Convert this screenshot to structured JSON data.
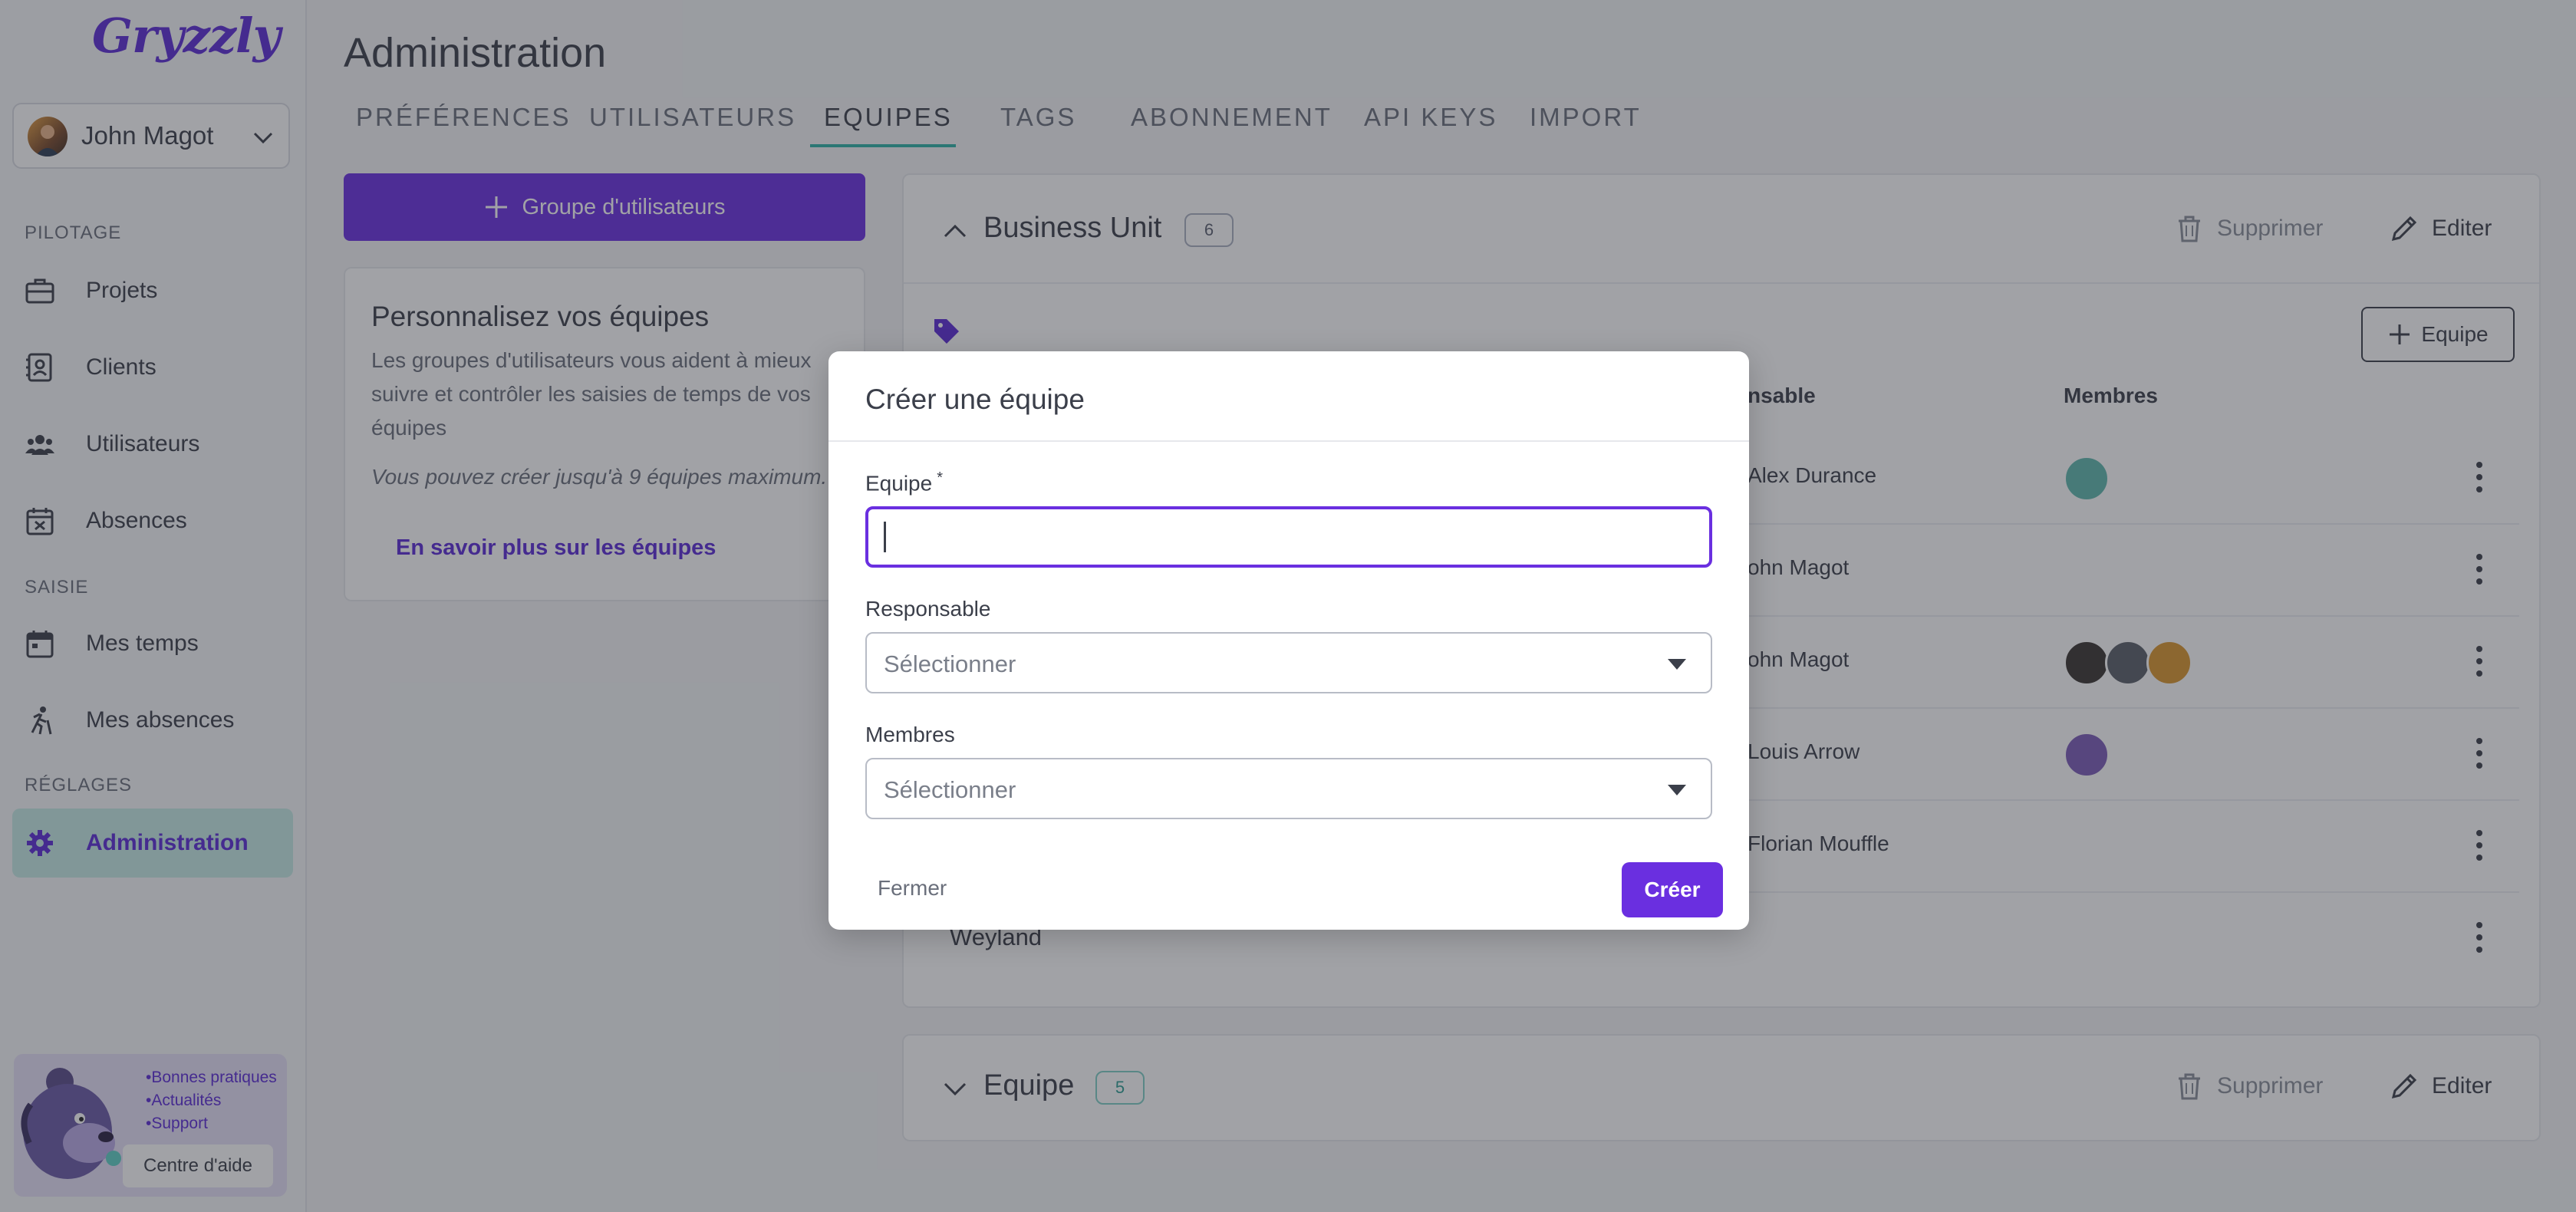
{
  "sidebar": {
    "logo": "Gryzzly",
    "user": {
      "name": "John Magot"
    },
    "sections": {
      "pilotage": "PILOTAGE",
      "saisie": "SAISIE",
      "reglages": "RÉGLAGES"
    },
    "items": [
      {
        "label": "Projets",
        "icon": "briefcase-icon"
      },
      {
        "label": "Clients",
        "icon": "contact-book-icon"
      },
      {
        "label": "Utilisateurs",
        "icon": "users-icon"
      },
      {
        "label": "Absences",
        "icon": "calendar-x-icon"
      },
      {
        "label": "Mes temps",
        "icon": "calendar-icon"
      },
      {
        "label": "Mes absences",
        "icon": "walking-icon"
      },
      {
        "label": "Administration",
        "icon": "gear-icon"
      }
    ],
    "help": {
      "links": [
        "•Bonnes pratiques",
        "•Actualités",
        "•Support"
      ],
      "button": "Centre d'aide"
    }
  },
  "header": {
    "title": "Administration",
    "tabs": [
      "PRÉFÉRENCES",
      "UTILISATEURS",
      "EQUIPES",
      "TAGS",
      "ABONNEMENT",
      "API KEYS",
      "IMPORT"
    ],
    "active_tab": "EQUIPES"
  },
  "left_panel": {
    "add_group_label": "Groupe d'utilisateurs",
    "card_title": "Personnalisez vos équipes",
    "card_desc": "Les groupes d'utilisateurs vous aident à mieux suivre et contrôler les saisies de temps de vos équipes",
    "card_limit": "Vous pouvez créer jusqu'à 9 équipes maximum.",
    "card_link": "En savoir plus sur les équipes"
  },
  "business_unit": {
    "title": "Business Unit",
    "count": "6",
    "delete_label": "Supprimer",
    "edit_label": "Editer",
    "add_team_label": "Equipe",
    "col_responsable": "nsable",
    "col_membres": "Membres",
    "rows": [
      {
        "name": "",
        "responsable": "Alex Durance",
        "members": 1
      },
      {
        "name": "",
        "responsable": "ohn Magot",
        "members": 0
      },
      {
        "name": "",
        "responsable": "ohn Magot",
        "members": 3
      },
      {
        "name": "",
        "responsable": "Louis Arrow",
        "members": 1
      },
      {
        "name": "",
        "responsable": "Florian Mouffle",
        "members": 0
      },
      {
        "name": "Weyland",
        "responsable": "",
        "members": 0
      }
    ]
  },
  "team_group": {
    "title": "Equipe",
    "count": "5",
    "delete_label": "Supprimer",
    "edit_label": "Editer"
  },
  "modal": {
    "title": "Créer une équipe",
    "team_label": "Equipe",
    "required_mark": "*",
    "team_value": "",
    "responsable_label": "Responsable",
    "responsable_placeholder": "Sélectionner",
    "members_label": "Membres",
    "members_placeholder": "Sélectionner",
    "close_label": "Fermer",
    "create_label": "Créer"
  },
  "colors": {
    "primary": "#6a2fe0",
    "accent": "#2db3a6",
    "active_nav_bg": "#c7ebe7"
  }
}
